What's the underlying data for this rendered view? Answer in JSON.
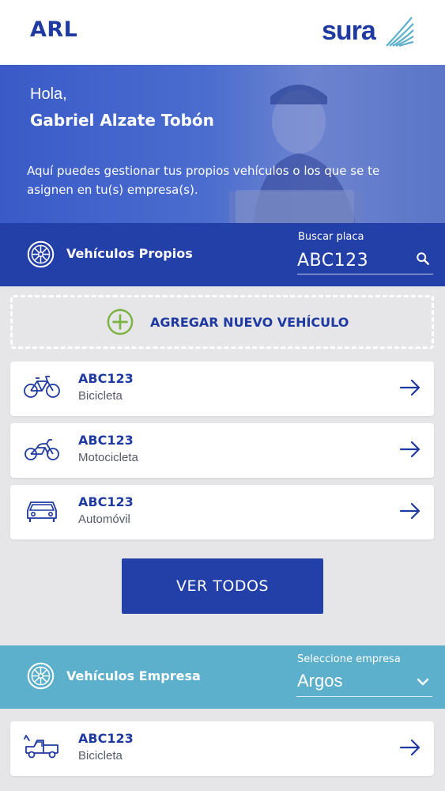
{
  "header": {
    "title": "ARL",
    "brand": "sura",
    "brand_icon": "sura-wings-logo"
  },
  "hero": {
    "greeting": "Hola,",
    "name": "Gabriel Alzate Tobón",
    "description": "Aquí puedes gestionar tus propios vehículos o los que se te asignen en tu(s) empresa(s)."
  },
  "own_vehicles": {
    "label": "Vehículos Propios",
    "icon": "wheel-icon",
    "search": {
      "caption": "Buscar placa",
      "value": "ABC123",
      "icon": "search-icon"
    }
  },
  "add_vehicle": {
    "label": "AGREGAR NUEVO VEHÍCULO",
    "icon": "plus-circle-icon"
  },
  "vehicles": [
    {
      "plate": "ABC123",
      "type": "Bicicleta",
      "icon": "bicycle-icon"
    },
    {
      "plate": "ABC123",
      "type": "Motocicleta",
      "icon": "motorcycle-icon"
    },
    {
      "plate": "ABC123",
      "type": "Automóvil",
      "icon": "car-icon"
    }
  ],
  "see_all_label": "VER TODOS",
  "company_vehicles": {
    "label": "Vehículos Empresa",
    "icon": "wheel-icon",
    "select": {
      "caption": "Seleccione empresa",
      "value": "Argos",
      "icon": "chevron-down-icon"
    },
    "items": [
      {
        "plate": "ABC123",
        "type": "Bicicleta",
        "icon": "tow-truck-icon"
      }
    ]
  },
  "colors": {
    "brand_blue": "#233fa8",
    "text_blue": "#1f3aa0",
    "company_teal": "#5db0cb",
    "add_green": "#7bb342",
    "background": "#e6e6e8"
  }
}
